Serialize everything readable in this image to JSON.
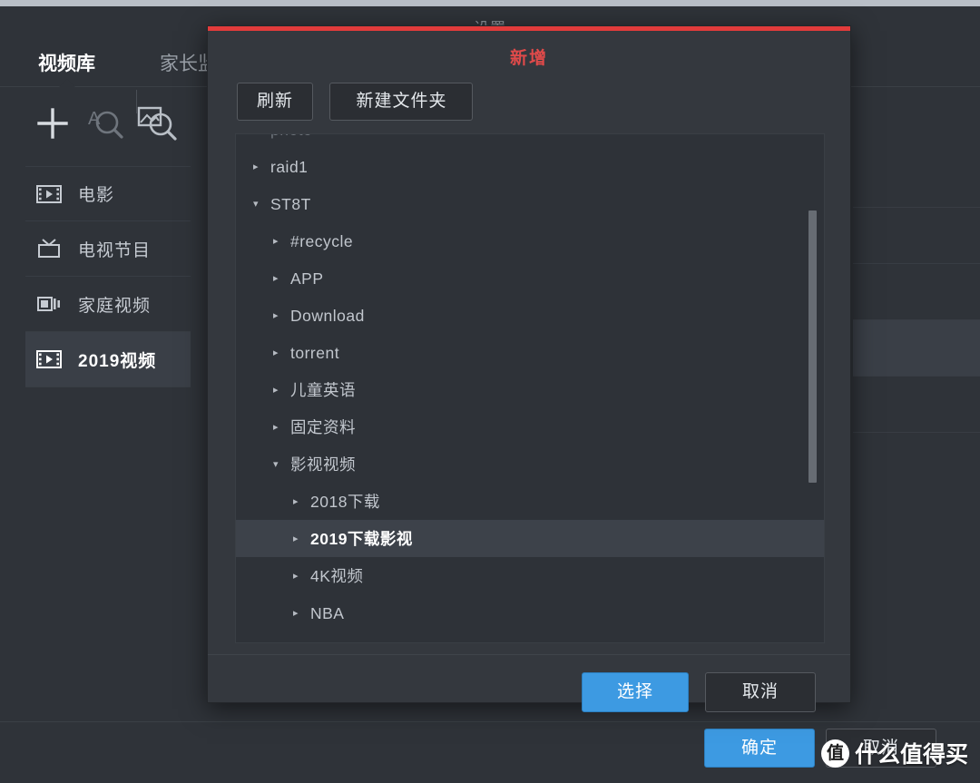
{
  "window": {
    "title": "设置",
    "tabs": [
      {
        "label": "视频库",
        "active": true
      },
      {
        "label": "家长监",
        "active": false
      }
    ],
    "toolbar_icons": [
      "plus-icon",
      "text-search-icon",
      "image-search-icon"
    ],
    "sidebar_items": [
      {
        "label": "电影",
        "icon": "film-strip-icon",
        "selected": false
      },
      {
        "label": "电视节目",
        "icon": "tv-icon",
        "selected": false
      },
      {
        "label": "家庭视频",
        "icon": "camcorder-icon",
        "selected": false
      },
      {
        "label": "2019视频",
        "icon": "film-strip-icon",
        "selected": true
      }
    ],
    "ok_label": "确定",
    "cancel_label": "取消"
  },
  "dialog": {
    "title": "新增",
    "accent_color": "#e23b3b",
    "title_color": "#e04a4a",
    "refresh_label": "刷新",
    "new_folder_label": "新建文件夹",
    "select_label": "选择",
    "cancel_label": "取消",
    "tree": [
      {
        "label": "photo",
        "indent": 1,
        "state": "collapsed",
        "selected": false,
        "clipped": true
      },
      {
        "label": "raid1",
        "indent": 1,
        "state": "collapsed",
        "selected": false
      },
      {
        "label": "ST8T",
        "indent": 1,
        "state": "expanded",
        "selected": false
      },
      {
        "label": "#recycle",
        "indent": 2,
        "state": "collapsed",
        "selected": false
      },
      {
        "label": "APP",
        "indent": 2,
        "state": "collapsed",
        "selected": false
      },
      {
        "label": "Download",
        "indent": 2,
        "state": "collapsed",
        "selected": false
      },
      {
        "label": "torrent",
        "indent": 2,
        "state": "collapsed",
        "selected": false
      },
      {
        "label": "儿童英语",
        "indent": 2,
        "state": "collapsed",
        "selected": false
      },
      {
        "label": "固定资料",
        "indent": 2,
        "state": "collapsed",
        "selected": false
      },
      {
        "label": "影视视频",
        "indent": 2,
        "state": "expanded",
        "selected": false
      },
      {
        "label": "2018下载",
        "indent": 3,
        "state": "collapsed",
        "selected": false
      },
      {
        "label": "2019下载影视",
        "indent": 3,
        "state": "collapsed",
        "selected": true
      },
      {
        "label": "4K视频",
        "indent": 3,
        "state": "collapsed",
        "selected": false
      },
      {
        "label": "NBA",
        "indent": 3,
        "state": "collapsed",
        "selected": false
      }
    ],
    "arrow_collapsed": "▸",
    "arrow_expanded": "▾"
  },
  "watermark": {
    "logo": "值",
    "text": "什么值得买"
  },
  "colors": {
    "accent_blue": "#3d9ae2",
    "accent_red": "#e23b3b",
    "bg_dark": "#2f3339",
    "bg_dialog": "#34383e",
    "selection": "#3d424a"
  }
}
